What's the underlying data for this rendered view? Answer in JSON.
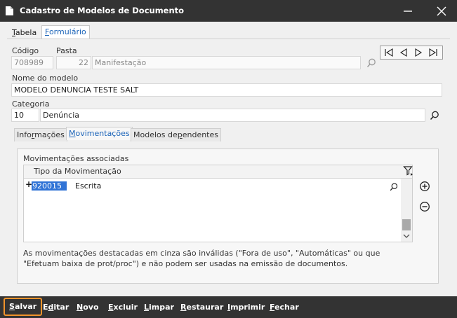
{
  "window": {
    "title": "Cadastro de Modelos de Documento"
  },
  "tabs": [
    {
      "label": "Tabela",
      "underline": "T",
      "rest": "abela"
    },
    {
      "label": "Formulário",
      "underline": "F",
      "rest": "ormulário"
    }
  ],
  "form": {
    "codigo_label": "Código",
    "codigo_value": "708989",
    "pasta_label": "Pasta",
    "pasta_code": "22",
    "pasta_name": "Manifestação",
    "nome_label": "Nome do modelo",
    "nome_value": "MODELO DENUNCIA TESTE SALT",
    "categoria_label": "Categoria",
    "categoria_code": "10",
    "categoria_name": "Denúncia"
  },
  "subtabs": [
    {
      "pre": "Info",
      "u": "r",
      "post": "mações"
    },
    {
      "pre": "",
      "u": "M",
      "post": "ovimentações"
    },
    {
      "pre": "Modelos de",
      "u": "p",
      "post": "endentes"
    }
  ],
  "movimentacoes": {
    "group_label": "Movimentações associadas",
    "column_header": "Tipo da Movimentação",
    "rows": [
      {
        "code": "920015",
        "name": "Escrita"
      }
    ],
    "info_text": "As movimentações destacadas em cinza são inválidas (\"Fora de uso\", \"Automáticas\" ou que \"Efetuam baixa de prot/proc\") e não podem ser usadas na emissão de documentos."
  },
  "toolbar": [
    {
      "u": "S",
      "rest": "alvar",
      "pre": ""
    },
    {
      "pre": "E",
      "u": "d",
      "rest": "itar"
    },
    {
      "pre": "",
      "u": "N",
      "rest": "ovo"
    },
    {
      "pre": "",
      "u": "E",
      "rest": "xcluir"
    },
    {
      "pre": "",
      "u": "L",
      "rest": "impar"
    },
    {
      "pre": "",
      "u": "R",
      "rest": "estaurar"
    },
    {
      "pre": "",
      "u": "I",
      "rest": "mprimir"
    },
    {
      "pre": "",
      "u": "F",
      "rest": "echar"
    }
  ],
  "colors": {
    "titlebar": "#333333",
    "accent": "#f0932b",
    "link": "#1a63b8",
    "selection": "#2f73d6"
  }
}
